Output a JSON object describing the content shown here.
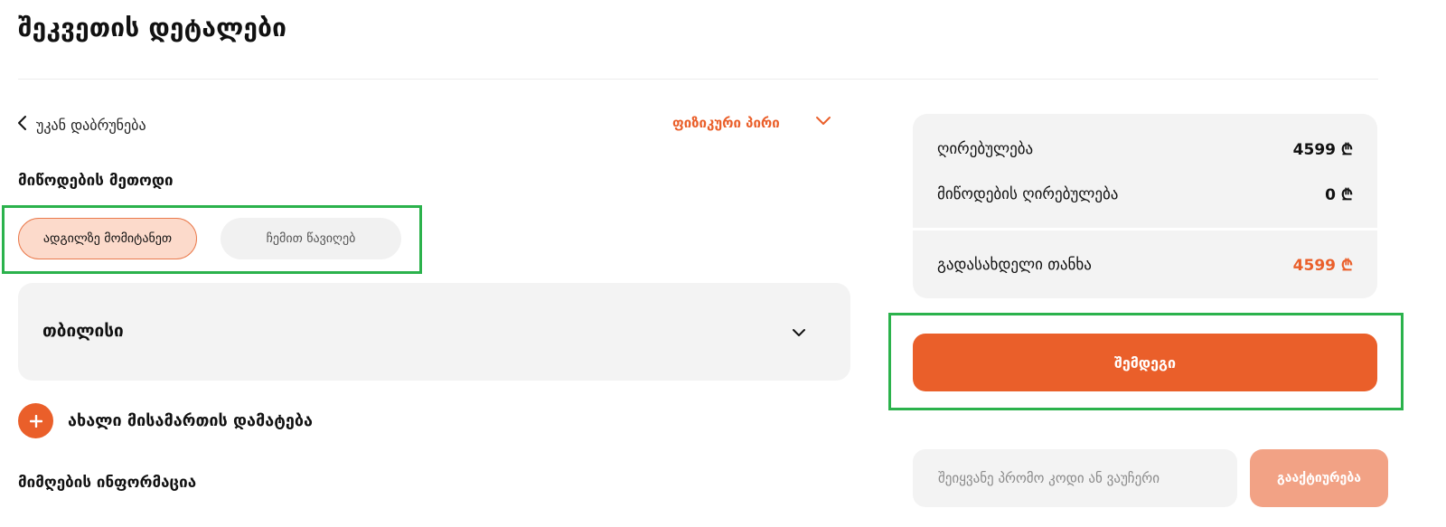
{
  "page_title": "შეკვეთის დეტალები",
  "back_label": "უკან დაბრუნება",
  "person_type": {
    "selected": "ფიზიკური პირი"
  },
  "delivery": {
    "title": "მიწოდების მეთოდი",
    "options": [
      "ადგილზე მომიტანეთ",
      "ჩემით წავიღებ"
    ],
    "selected_index": 0,
    "city": "თბილისი",
    "add_address_label": "ახალი მისამართის დამატება"
  },
  "receiver": {
    "title": "მიმღების ინფორმაცია"
  },
  "summary": {
    "price_label": "ღირებულება",
    "price_value": "4599 ₾",
    "delivery_label": "მიწოდების ღირებულება",
    "delivery_value": "0 ₾",
    "total_label": "გადასახდელი თანხა",
    "total_value": "4599 ₾"
  },
  "next_label": "შემდეგი",
  "promo": {
    "placeholder": "შეიყვანე პრომო კოდი ან ვაუჩერი",
    "value": "",
    "button_label": "გააქტიურება"
  },
  "colors": {
    "accent": "#ea5f2a",
    "highlight": "#2bb24c",
    "panel": "#f3f3f3"
  },
  "icons": [
    "chevron-left-icon",
    "chevron-down-icon",
    "plus-icon"
  ]
}
